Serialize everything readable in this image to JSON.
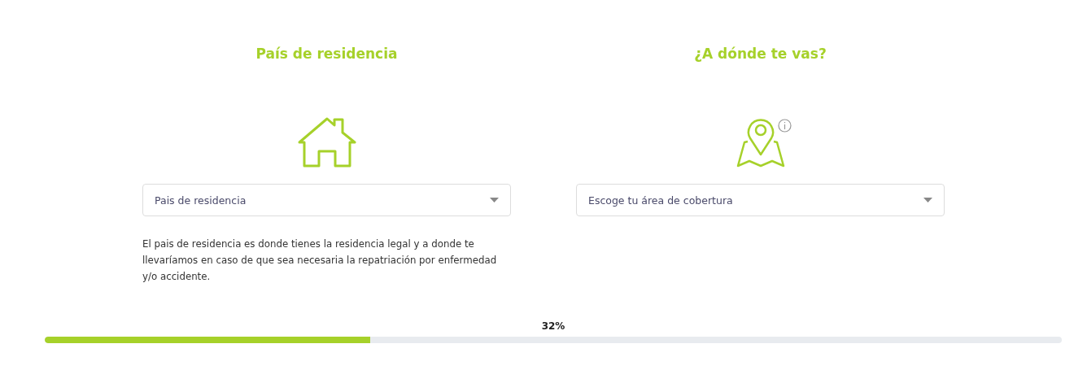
{
  "columns": [
    {
      "kind": "home",
      "title": "País de residencia",
      "info": false,
      "select": {
        "placeholder": "Pais de residencia"
      },
      "help": "El pais de residencia es donde tienes la residencia legal y a donde te llevaríamos en caso de que sea necesaria la repatriación por enfermedad y/o accidente."
    },
    {
      "kind": "map",
      "title": "¿A dónde te vas?",
      "info": true,
      "select": {
        "placeholder": "Escoge tu área de cobertura"
      }
    }
  ],
  "progress": {
    "reading": "32%",
    "level": 0.32
  }
}
